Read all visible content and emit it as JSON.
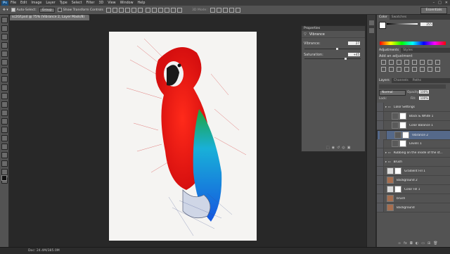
{
  "app_logo": "Ps",
  "menu": [
    "File",
    "Edit",
    "Image",
    "Layer",
    "Type",
    "Select",
    "Filter",
    "3D",
    "View",
    "Window",
    "Help"
  ],
  "options_bar": {
    "auto_select_label": "Auto-Select:",
    "auto_select_value": "Group",
    "transform_label": "Show Transform Controls",
    "mode_label": "3D Mode:"
  },
  "workspace": "Essentials",
  "doc_tab": "sc2Gf.psd @ 75% (Vibrance 2, Layer Mask/8)",
  "properties": {
    "tab": "Properties",
    "panel_title": "Vibrance",
    "vibrance_label": "Vibrance:",
    "vibrance_value": "27",
    "vibrance_level": 0.57,
    "saturation_label": "Saturation:",
    "saturation_value": "+45",
    "saturation_level": 0.72
  },
  "color_panel": {
    "tabs": [
      "Color",
      "Swatches"
    ],
    "value": "255"
  },
  "adjustments_panel": {
    "tabs": [
      "Adjustments",
      "Styles"
    ],
    "title": "Add an adjustment"
  },
  "layers_panel": {
    "tabs": [
      "Layers",
      "Channels",
      "Paths"
    ],
    "blend_mode": "Normal",
    "opacity_label": "Opacity:",
    "opacity_value": "100%",
    "lock_label": "Lock:",
    "fill_label": "Fill:",
    "fill_value": "100%",
    "layers": [
      {
        "name": "Color Settings",
        "kind": "group",
        "indent": 0,
        "selected": false
      },
      {
        "name": "Black & White 1",
        "kind": "adjust",
        "indent": 1,
        "selected": false
      },
      {
        "name": "Color Balance 1",
        "kind": "adjust",
        "indent": 1,
        "selected": false
      },
      {
        "name": "Vibrance 2",
        "kind": "adjust",
        "indent": 1,
        "selected": true
      },
      {
        "name": "Levels 1",
        "kind": "adjust",
        "indent": 1,
        "selected": false
      },
      {
        "name": "Rubbing on the inside of the st...",
        "kind": "group",
        "indent": 0,
        "selected": false
      },
      {
        "name": "Brush",
        "kind": "group",
        "indent": 0,
        "selected": false
      },
      {
        "name": "Gradient Fill 1",
        "kind": "fill",
        "indent": 0,
        "selected": false
      },
      {
        "name": "Background 2",
        "kind": "pixel",
        "indent": 0,
        "selected": false
      },
      {
        "name": "Color Fill 1",
        "kind": "fill",
        "indent": 0,
        "selected": false
      },
      {
        "name": "brush",
        "kind": "pixel",
        "indent": 0,
        "selected": false
      },
      {
        "name": "Background",
        "kind": "pixel",
        "indent": 0,
        "selected": false
      }
    ]
  },
  "status_bar": {
    "doc_info": "Doc: 24.4M/385.0M"
  }
}
